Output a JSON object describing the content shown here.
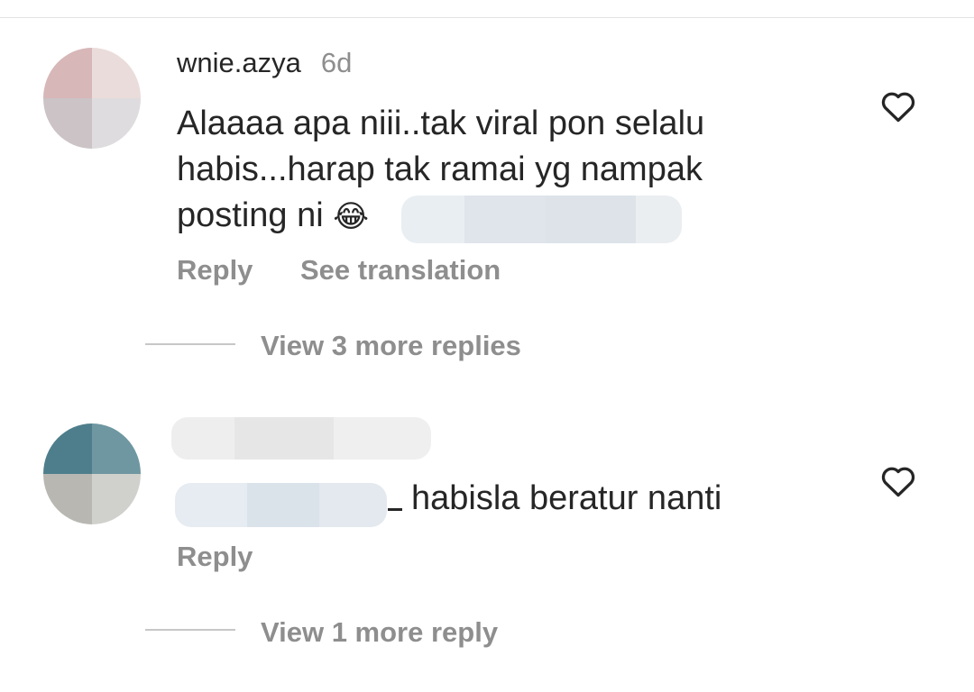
{
  "comments": [
    {
      "username": "wnie.azya",
      "timestamp": "6d",
      "text_lines": [
        "Alaaaa apa niii..tak viral pon selalu",
        "habis...harap tak ramai yg nampak",
        "posting ni"
      ],
      "emoji": "😂",
      "actions": {
        "reply": "Reply",
        "see_translation": "See translation"
      },
      "view_replies": "View 3 more replies",
      "colors": {
        "avatar": [
          "#d7b7b8",
          "#eadcda",
          "#cbc3c6",
          "#dedcde"
        ]
      }
    },
    {
      "text": "habisla beratur nanti",
      "actions": {
        "reply": "Reply"
      },
      "view_replies": "View 1 more reply",
      "colors": {
        "avatar": [
          "#4e7e8b",
          "#6e97a1",
          "#b8b7b2",
          "#d0d0cc"
        ]
      }
    }
  ],
  "icons": {
    "like": "heart-outline-icon"
  },
  "colors": {
    "primary_text": "#262626",
    "secondary_text": "#8e8e8e",
    "divider": "#c7c7c7",
    "blur": "#dfe5ea"
  }
}
